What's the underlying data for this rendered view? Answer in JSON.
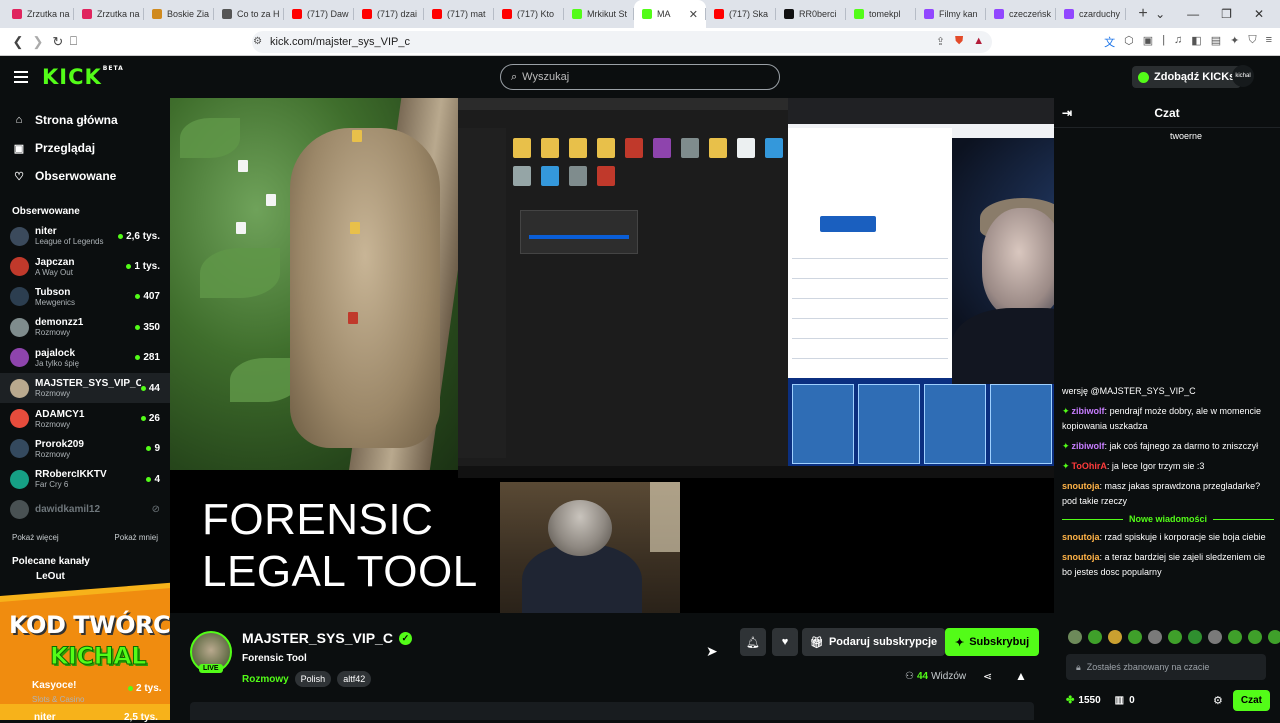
{
  "browser": {
    "tabs": [
      {
        "label": "Zrzutka na",
        "color": "#e0245e"
      },
      {
        "label": "Zrzutka na",
        "color": "#e0245e"
      },
      {
        "label": "Boskie Zia",
        "color": "#d08a1e"
      },
      {
        "label": "Co to za H",
        "color": "#555555"
      },
      {
        "label": "(717) Daw",
        "color": "#ff0000"
      },
      {
        "label": "(717) dzai",
        "color": "#ff0000"
      },
      {
        "label": "(717) mat",
        "color": "#ff0000"
      },
      {
        "label": "(717) Kto",
        "color": "#ff0000"
      },
      {
        "label": "Mrkikut St",
        "color": "#53fc18"
      },
      {
        "label": "MA",
        "color": "#53fc18"
      },
      {
        "label": "(717) Ska",
        "color": "#ff0000"
      },
      {
        "label": "RR0berci",
        "color": "#111111"
      },
      {
        "label": "tomekpl",
        "color": "#53fc18"
      },
      {
        "label": "Filmy kan",
        "color": "#9146ff"
      },
      {
        "label": "czeczeńsk",
        "color": "#9146ff"
      },
      {
        "label": "czarduchy",
        "color": "#9146ff"
      }
    ],
    "active_tab_index": 9,
    "url": "kick.com/majster_sys_VIP_c"
  },
  "header": {
    "logo": "KICK",
    "logo_sup": "BETA",
    "search_placeholder": "Wyszukaj",
    "kicks_button": "Zdobądź KICKs",
    "user_avatar": "kichal"
  },
  "sidebar": {
    "nav": [
      {
        "label": "Strona główna",
        "icon": "⌂"
      },
      {
        "label": "Przeglądaj",
        "icon": "▣"
      },
      {
        "label": "Obserwowane",
        "icon": "♡"
      }
    ],
    "followed_title": "Obserwowane",
    "channels": [
      {
        "name": "niter",
        "category": "League of Legends",
        "viewers": "2,6 tys.",
        "color": "#3b4a5c"
      },
      {
        "name": "Japczan",
        "category": "A Way Out",
        "viewers": "1 tys.",
        "color": "#c0392b"
      },
      {
        "name": "Tubson",
        "category": "Mewgenics",
        "viewers": "407",
        "color": "#2c3e50"
      },
      {
        "name": "demonzz1",
        "category": "Rozmowy",
        "viewers": "350",
        "color": "#7f8c8d"
      },
      {
        "name": "pajalock",
        "category": "Ja tylko śpię",
        "viewers": "281",
        "color": "#8e44ad"
      },
      {
        "name": "MAJSTER_SYS_VIP_C",
        "category": "Rozmowy",
        "viewers": "44",
        "color": "#b9a98e",
        "selected": true
      },
      {
        "name": "ADAMCY1",
        "category": "Rozmowy",
        "viewers": "26",
        "color": "#e74c3c"
      },
      {
        "name": "Prorok209",
        "category": "Rozmowy",
        "viewers": "9",
        "color": "#34495e"
      },
      {
        "name": "RRobercIKKTV",
        "category": "Far Cry 6",
        "viewers": "4",
        "color": "#16a085"
      },
      {
        "name": "dawidkamil12",
        "category": "",
        "viewers": "",
        "color": "#95a5a6",
        "offline": true
      }
    ],
    "show_more": "Pokaż więcej",
    "show_less": "Pokaż mniej",
    "recommended_title": "Polecane kanały",
    "rec_peek_1": {
      "name": "Kasyoce!",
      "category": "Slots & Casino",
      "viewers": "2 tys."
    },
    "rec_peek_2": {
      "name": "niter",
      "viewers": "2,5 tys."
    },
    "rec_peek_0": "LeOut"
  },
  "overlay_banner": {
    "line1": "KOD TWÓRCY",
    "line2": "KICHAL"
  },
  "video": {
    "overlay_text_line1": "FORENSIC",
    "overlay_text_line2": "LEGAL TOOL"
  },
  "stream_info": {
    "streamer": "MAJSTER_SYS_VIP_C",
    "live": "LIVE",
    "title": "Forensic Tool",
    "category": "Rozmowy",
    "tags": [
      "Polish",
      "altf42"
    ],
    "gift_button": "Podaruj subskrypcje",
    "subscribe_button": "Subskrybuj",
    "viewers_count": "44",
    "viewers_label": "Widzów"
  },
  "chat": {
    "title": "Czat",
    "pinned_peek": "twoerne",
    "messages": [
      {
        "user": "",
        "text": "wersję @MAJSTER_SYS_VIP_C",
        "color": "#ffffff",
        "badge": false
      },
      {
        "user": "zibiwolf",
        "text": "pendrajf może dobry, ale w momencie kopiowania uszkadza",
        "color": "#c77dff",
        "badge": true
      },
      {
        "user": "zibiwolf",
        "text": "jak coś fajnego za darmo to zniszczył",
        "color": "#c77dff",
        "badge": true
      },
      {
        "user": "ToOhirA",
        "text": "ja lece Igor trzym sie :3",
        "color": "#ff3b3b",
        "badge": true
      },
      {
        "user": "snoutoja",
        "text": "masz jakas sprawdzona przegladarke? pod takie rzeczy",
        "color": "#ffb347",
        "badge": false
      }
    ],
    "new_messages_label": "Nowe wiadomości",
    "messages_after": [
      {
        "user": "snoutoja",
        "text": "rzad spiskuje i korporacje sie boja ciebie",
        "color": "#ffb347"
      },
      {
        "user": "snoutoja",
        "text": "a teraz bardziej sie zajeli sledzeniem cie bo jestes dosc popularny",
        "color": "#ffb347"
      }
    ],
    "banned_placeholder": "Zostałeś zbanowany na czacie",
    "points": "1550",
    "gift_count": "0",
    "chat_button": "Czat"
  }
}
